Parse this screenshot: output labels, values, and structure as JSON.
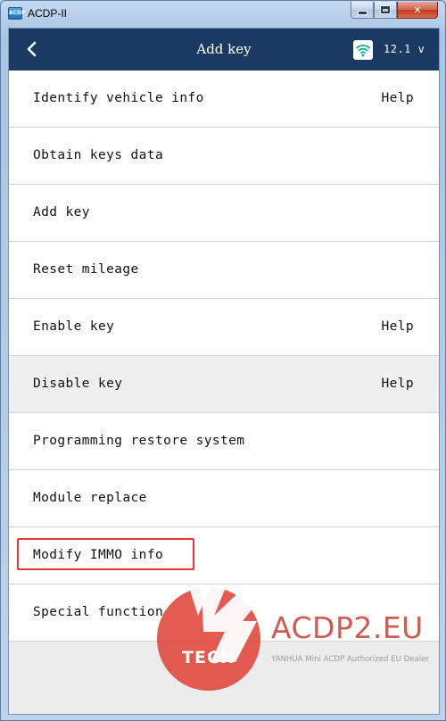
{
  "window": {
    "title": "ACDP-II",
    "icon_name": "acdp-app-icon",
    "controls": {
      "minimize": "minimize-icon",
      "maximize": "maximize-icon",
      "close": "✕"
    }
  },
  "header": {
    "back_icon": "chevron-left-icon",
    "title": "Add key",
    "wifi_icon": "wifi-icon",
    "voltage": "12.1 v",
    "bg_color": "#1b3a63"
  },
  "menu": {
    "items": [
      {
        "label": "Identify vehicle info",
        "help": "Help",
        "shaded": false,
        "highlighted": false
      },
      {
        "label": "Obtain keys data",
        "help": "",
        "shaded": false,
        "highlighted": false
      },
      {
        "label": "Add key",
        "help": "",
        "shaded": false,
        "highlighted": false
      },
      {
        "label": "Reset mileage",
        "help": "",
        "shaded": false,
        "highlighted": false
      },
      {
        "label": "Enable key",
        "help": "Help",
        "shaded": false,
        "highlighted": false
      },
      {
        "label": "Disable key",
        "help": "Help",
        "shaded": true,
        "highlighted": false
      },
      {
        "label": "Programming restore system",
        "help": "",
        "shaded": false,
        "highlighted": false
      },
      {
        "label": "Module replace",
        "help": "",
        "shaded": false,
        "highlighted": false
      },
      {
        "label": "Modify IMMO info",
        "help": "",
        "shaded": false,
        "highlighted": true
      },
      {
        "label": "Special function",
        "help": "",
        "shaded": false,
        "highlighted": false
      }
    ],
    "highlight_color": "#e53935"
  },
  "watermark": {
    "url": "ACDP2.EU",
    "tagline": "YANHUA Mini ACDP Authorized EU Dealer",
    "tech": "TECH",
    "accent_color": "#e0443a"
  }
}
